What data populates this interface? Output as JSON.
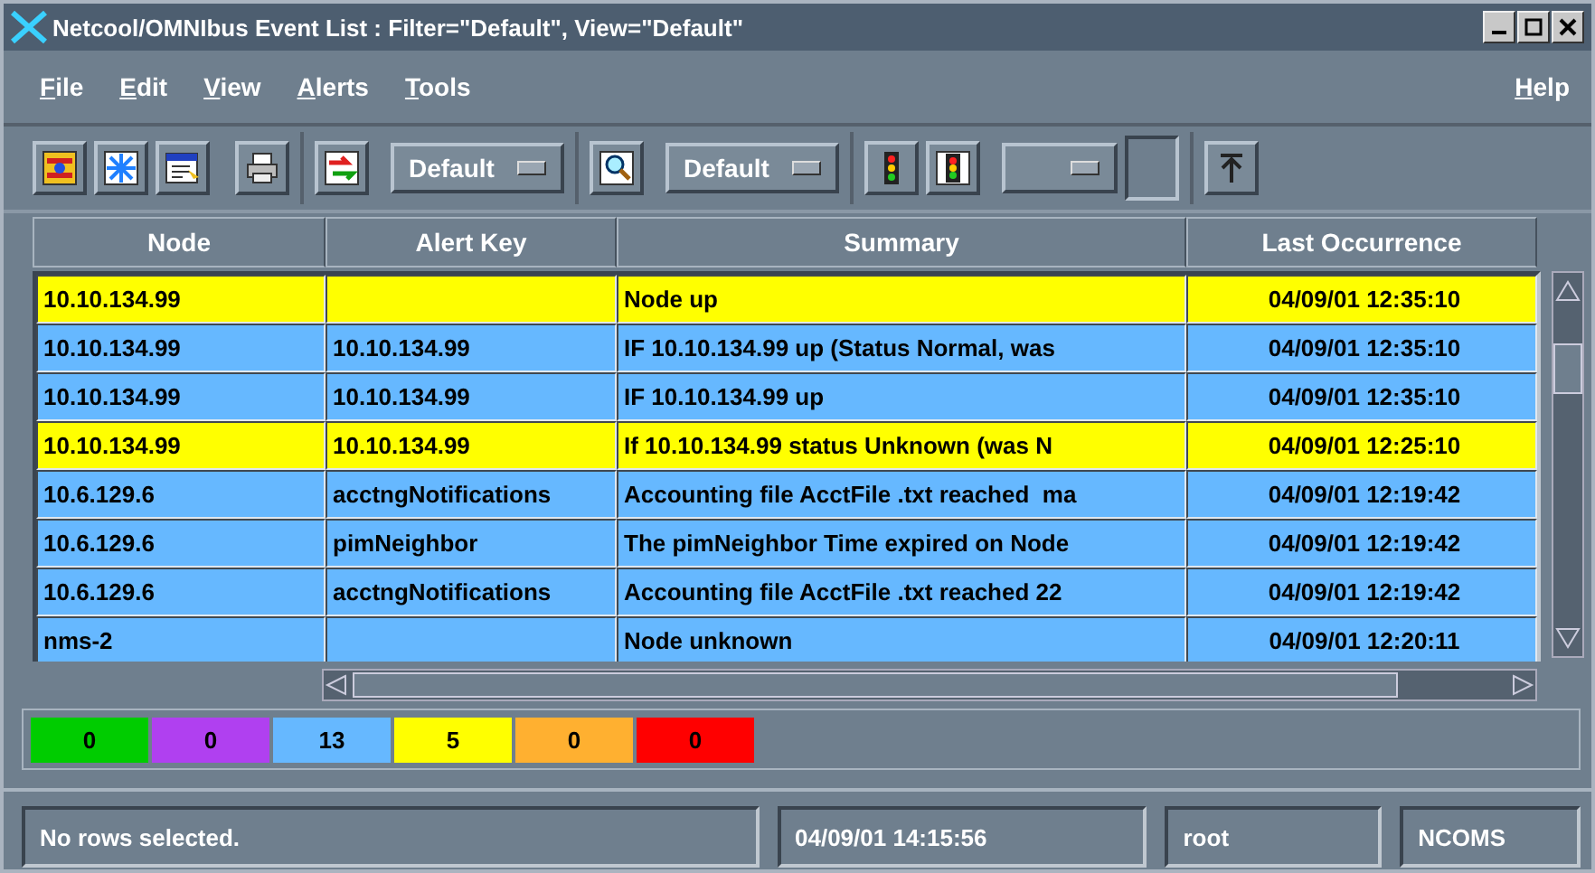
{
  "window": {
    "title": "Netcool/OMNIbus Event List : Filter=\"Default\", View=\"Default\""
  },
  "menu": {
    "left": [
      "File",
      "Edit",
      "View",
      "Alerts",
      "Tools"
    ],
    "right": [
      "Help"
    ]
  },
  "toolbar": {
    "filter": {
      "value": "Default"
    },
    "view": {
      "value": "Default"
    }
  },
  "table": {
    "columns": [
      "Node",
      "Alert Key",
      "Summary",
      "Last Occurrence"
    ],
    "rows": [
      {
        "color": "#ffff00",
        "cells": [
          "10.10.134.99",
          "",
          "Node up",
          "04/09/01 12:35:10"
        ]
      },
      {
        "color": "#66b8ff",
        "cells": [
          "10.10.134.99",
          "10.10.134.99",
          "IF 10.10.134.99 up (Status Normal, was",
          "04/09/01 12:35:10"
        ]
      },
      {
        "color": "#66b8ff",
        "cells": [
          "10.10.134.99",
          "10.10.134.99",
          "IF 10.10.134.99 up",
          "04/09/01 12:35:10"
        ]
      },
      {
        "color": "#ffff00",
        "cells": [
          "10.10.134.99",
          "10.10.134.99",
          "If 10.10.134.99 status Unknown (was N",
          "04/09/01 12:25:10"
        ]
      },
      {
        "color": "#66b8ff",
        "cells": [
          "10.6.129.6",
          "acctngNotifications",
          "Accounting file AcctFile .txt reached  ma",
          "04/09/01 12:19:42"
        ]
      },
      {
        "color": "#66b8ff",
        "cells": [
          "10.6.129.6",
          "pimNeighbor",
          "The pimNeighbor Time expired on Node",
          "04/09/01 12:19:42"
        ]
      },
      {
        "color": "#66b8ff",
        "cells": [
          "10.6.129.6",
          "acctngNotifications",
          "Accounting file AcctFile .txt reached 22",
          "04/09/01 12:19:42"
        ]
      },
      {
        "color": "#66b8ff",
        "cells": [
          "nms-2",
          "",
          "Node unknown",
          "04/09/01 12:20:11"
        ]
      }
    ]
  },
  "severity_counts": [
    {
      "color": "#00cc00",
      "count": "0"
    },
    {
      "color": "#b040f0",
      "count": "0"
    },
    {
      "color": "#66b8ff",
      "count": "13"
    },
    {
      "color": "#ffff00",
      "count": "5"
    },
    {
      "color": "#ffb030",
      "count": "0"
    },
    {
      "color": "#ff0000",
      "count": "0"
    }
  ],
  "status_bar": {
    "message": "No rows selected.",
    "time": "04/09/01 14:15:56",
    "user": "root",
    "server": "NCOMS"
  }
}
